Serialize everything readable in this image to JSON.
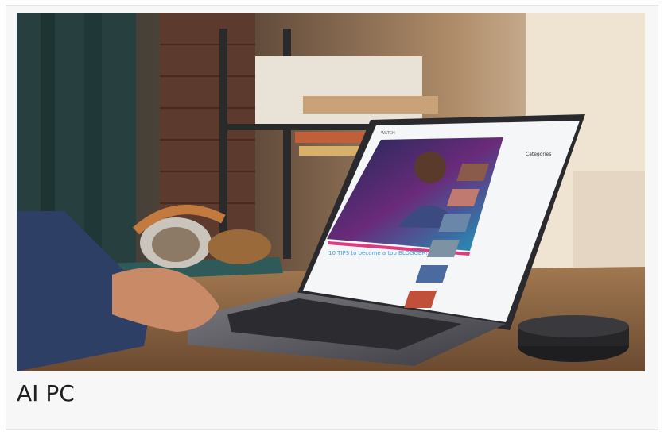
{
  "caption": "AI PC",
  "photo": {
    "screen_title": "10 TIPS to become a top BLOGGER!",
    "screen_brand": "WATCH",
    "screen_sidebar_heading": "Categories"
  },
  "colors": {
    "caption_text": "#1f1f1f",
    "card_bg": "#f7f7f7",
    "accent": "#3aa0e0"
  }
}
